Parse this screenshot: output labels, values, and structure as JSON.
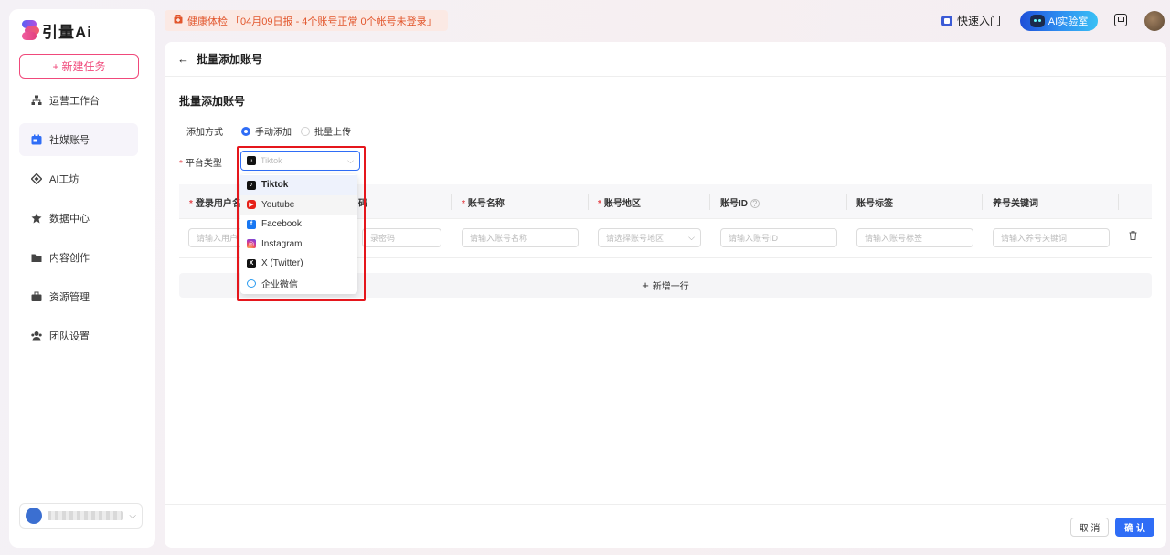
{
  "app": {
    "name": "引量Ai"
  },
  "sidebar": {
    "new_task": "新建任务",
    "items": [
      {
        "label": "运营工作台",
        "icon": "sitemap-icon"
      },
      {
        "label": "社媒账号",
        "icon": "calendar-icon",
        "active": true
      },
      {
        "label": "AI工坊",
        "icon": "ai-diamond-icon"
      },
      {
        "label": "数据中心",
        "icon": "star-burst-icon"
      },
      {
        "label": "内容创作",
        "icon": "folder-icon"
      },
      {
        "label": "资源管理",
        "icon": "briefcase-icon"
      },
      {
        "label": "团队设置",
        "icon": "team-icon"
      }
    ]
  },
  "topbar": {
    "banner": "健康体检 「04月09日报 - 4个账号正常 0个帐号未登录」",
    "quick_entry": "快速入门",
    "ai_lab": "AI实验室"
  },
  "page": {
    "title": "批量添加账号",
    "section_title": "批量添加账号",
    "add_method_label": "添加方式",
    "methods": [
      "手动添加",
      "批量上传"
    ],
    "selected_method": "手动添加",
    "platform_label": "平台类型",
    "platform_placeholder": "Tiktok"
  },
  "dropdown": {
    "options": [
      {
        "label": "Tiktok",
        "icon": "tiktok-icon"
      },
      {
        "label": "Youtube",
        "icon": "youtube-icon"
      },
      {
        "label": "Facebook",
        "icon": "facebook-icon"
      },
      {
        "label": "Instagram",
        "icon": "instagram-icon"
      },
      {
        "label": "X (Twitter)",
        "icon": "x-twitter-icon"
      },
      {
        "label": "企业微信",
        "icon": "wecom-icon"
      }
    ],
    "selected": "Tiktok",
    "hovered": "Youtube"
  },
  "table": {
    "headers": [
      "登录用户名",
      "码",
      "账号名称",
      "账号地区",
      "账号ID",
      "账号标签",
      "养号关键词"
    ],
    "row": {
      "username_placeholder": "请输入用户",
      "password_placeholder": "录密码",
      "name_placeholder": "请输入账号名称",
      "region_placeholder": "请选择账号地区",
      "id_placeholder": "请输入账号ID",
      "tag_placeholder": "请输入账号标签",
      "keyword_placeholder": "请输入养号关键词"
    },
    "add_row": "新增一行"
  },
  "footer": {
    "cancel": "取 消",
    "confirm": "确 认"
  },
  "colors": {
    "accent": "#2f6df6",
    "brand_pink": "#f0497b",
    "highlight_red": "#e5161c"
  }
}
